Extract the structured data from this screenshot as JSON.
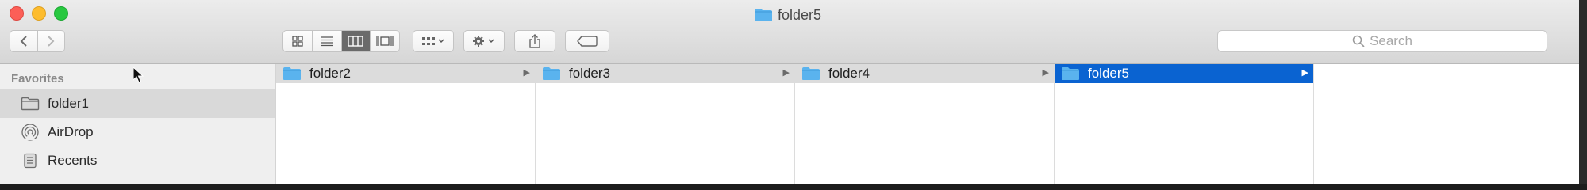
{
  "window": {
    "title": "folder5"
  },
  "toolbar": {
    "back_icon": "chevron-left",
    "forward_icon": "chevron-right",
    "views": [
      "icon-view",
      "list-view",
      "column-view",
      "gallery-view"
    ],
    "active_view": "column-view",
    "search_placeholder": "Search"
  },
  "sidebar": {
    "heading": "Favorites",
    "items": [
      {
        "label": "folder1",
        "icon": "folder-icon",
        "selected": true
      },
      {
        "label": "AirDrop",
        "icon": "airdrop-icon",
        "selected": false
      },
      {
        "label": "Recents",
        "icon": "recents-icon",
        "selected": false
      }
    ]
  },
  "columns": [
    {
      "item": "folder2",
      "active": false
    },
    {
      "item": "folder3",
      "active": false
    },
    {
      "item": "folder4",
      "active": false
    },
    {
      "item": "folder5",
      "active": true
    }
  ],
  "colors": {
    "selection": "#0a63d1",
    "folder": "#5ab3ee"
  }
}
